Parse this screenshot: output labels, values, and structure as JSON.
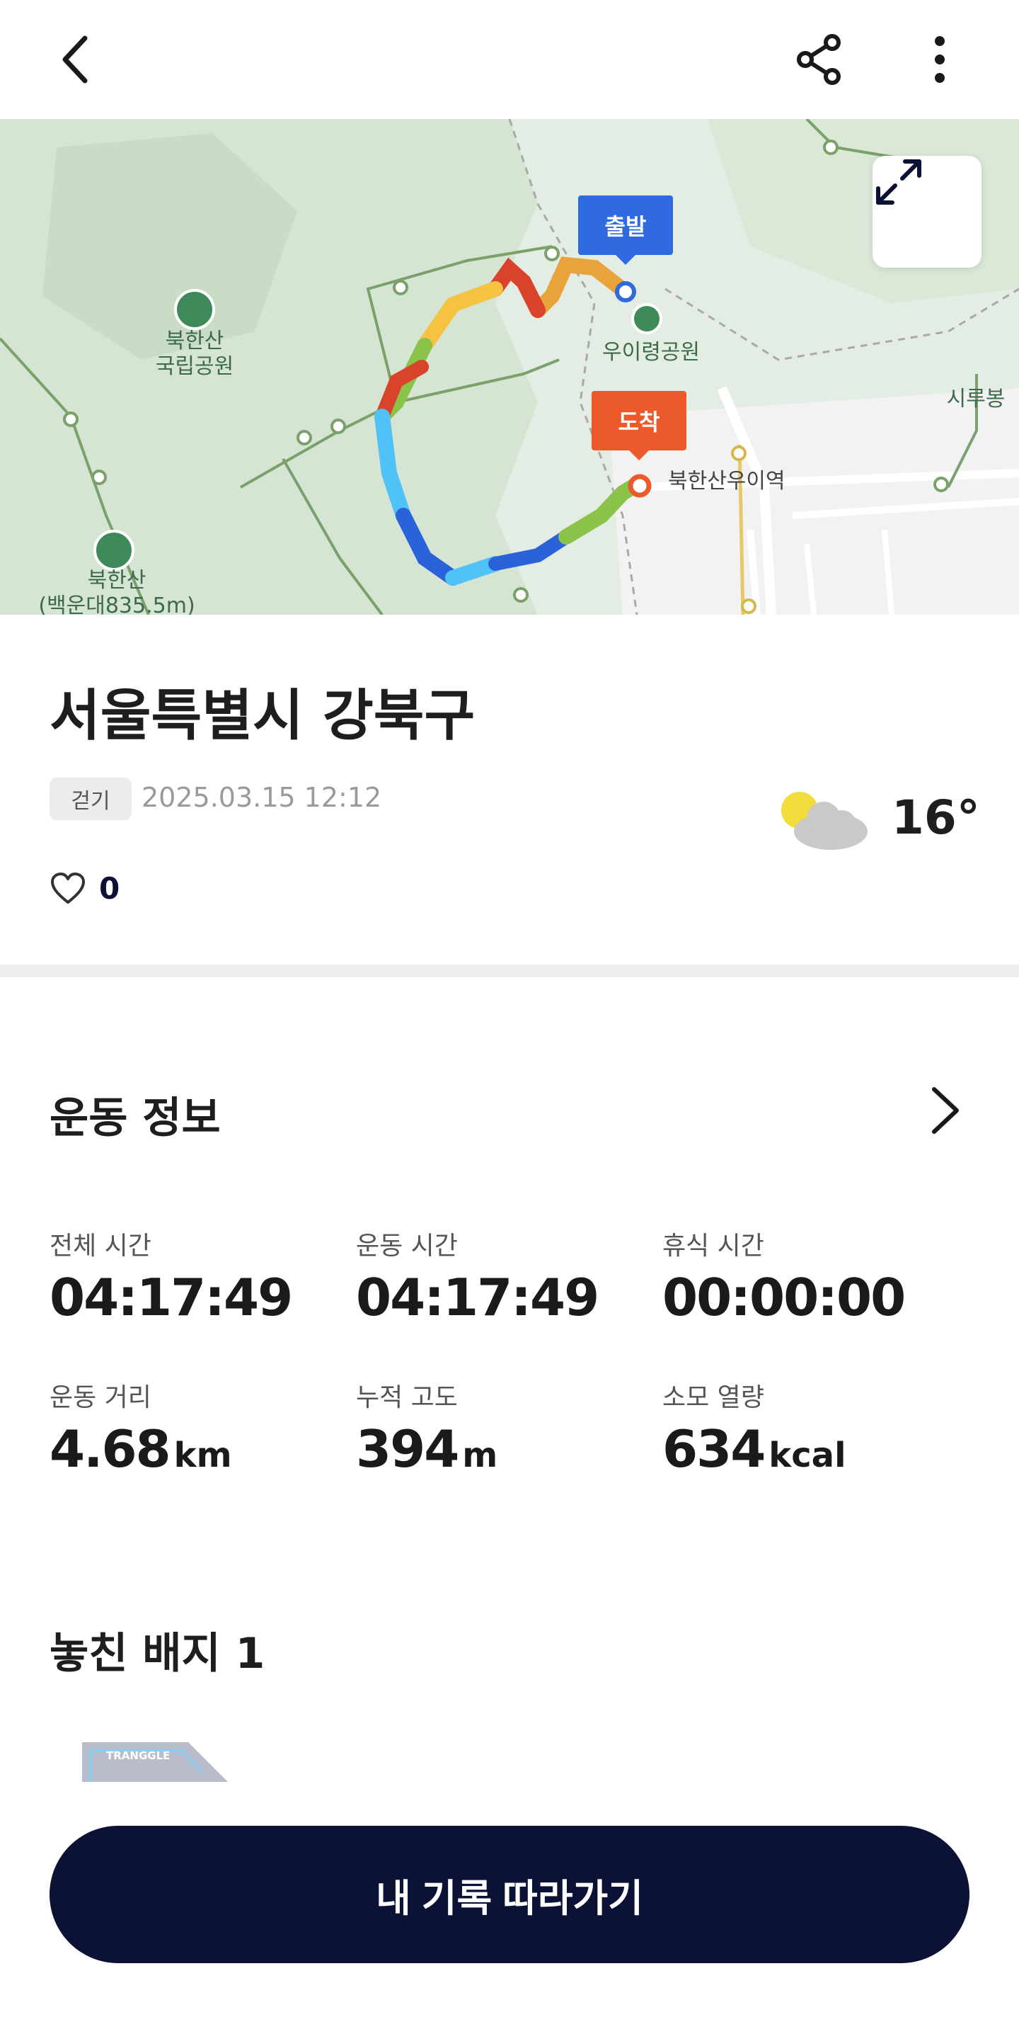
{
  "header": {
    "back_icon": "chevron-left-icon",
    "share_icon": "share-icon",
    "more_icon": "more-vertical-icon"
  },
  "map": {
    "start_label": "출발",
    "end_label": "도착",
    "labels": {
      "bukhansan_park": "북한산\n국립공원",
      "uiryeong_park": "우이령공원",
      "bukhansan_uie_station": "북한산우이역",
      "sirubong": "시루봉",
      "bukhansan_peak": "북한산\n(백운대835.5m)"
    },
    "expand_icon": "expand-arrows-icon",
    "route_colors": [
      "#8bc34a",
      "#f5c242",
      "#e8a33b",
      "#d9432b",
      "#4fc3f7",
      "#2a63d9"
    ]
  },
  "summary": {
    "title": "서울특별시 강북구",
    "activity_type": "걷기",
    "datetime": "2025.03.15 12:12",
    "weather_icon": "partly-cloudy-icon",
    "temperature": "16°",
    "like_icon": "heart-icon",
    "like_count": "0"
  },
  "exercise_info": {
    "title": "운동 정보",
    "stats": [
      {
        "label": "전체 시간",
        "value": "04:17:49",
        "unit": ""
      },
      {
        "label": "운동 시간",
        "value": "04:17:49",
        "unit": ""
      },
      {
        "label": "휴식 시간",
        "value": "00:00:00",
        "unit": ""
      },
      {
        "label": "운동 거리",
        "value": "4.68",
        "unit": "km"
      },
      {
        "label": "누적 고도",
        "value": "394",
        "unit": "m"
      },
      {
        "label": "소모 열량",
        "value": "634",
        "unit": "kcal"
      }
    ]
  },
  "badges": {
    "title": "놓친 배지 1",
    "badge_text": "TRANGGLE"
  },
  "cta": {
    "label": "내 기록 따라가기"
  }
}
